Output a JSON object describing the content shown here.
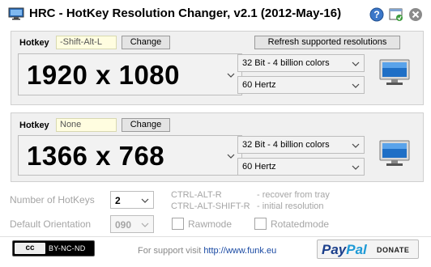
{
  "window": {
    "title": "HRC - HotKey Resolution Changer, v2.1 (2012-May-16)"
  },
  "titlebar_buttons": [
    {
      "name": "help-icon",
      "color": "#3b77c9"
    },
    {
      "name": "tray-icon",
      "color": "#2e8b2e"
    },
    {
      "name": "close-icon",
      "color": "#8a8a8a"
    }
  ],
  "panels": [
    {
      "hotkey_label": "Hotkey",
      "hotkey_value": "-Shift-Alt-L",
      "change_label": "Change",
      "refresh_label": "Refresh supported resolutions",
      "resolution": "1920 x 1080",
      "color_depth": "32 Bit - 4 billion colors",
      "refresh_rate": "60 Hertz"
    },
    {
      "hotkey_label": "Hotkey",
      "hotkey_value": "None",
      "change_label": "Change",
      "resolution": "1366 x 768",
      "color_depth": "32 Bit - 4 billion colors",
      "refresh_rate": "60 Hertz"
    }
  ],
  "settings": {
    "num_hotkeys_label": "Number of HotKeys",
    "num_hotkeys_value": "2",
    "orientation_label": "Default Orientation",
    "orientation_value": "090",
    "shortcut_1": "CTRL-ALT-R",
    "shortcut_1_desc": "- recover from tray",
    "shortcut_2": "CTRL-ALT-SHIFT-R",
    "shortcut_2_desc": "- initial resolution",
    "rawmode_label": "Rawmode",
    "rotatedmode_label": "Rotatedmode"
  },
  "footer": {
    "cc_left": "cc",
    "cc_right": "BY-NC-ND",
    "support_text": "For support visit",
    "support_link": "http://www.funk.eu",
    "paypal_pay": "Pay",
    "paypal_pal": "Pal",
    "donate_label": "DONATE"
  },
  "colors": {
    "hotkey_field_bg": "#fffde0",
    "panel_bg": "#f0f0f0",
    "disabled_text": "#a5a5a5",
    "link": "#1a4aa3"
  }
}
